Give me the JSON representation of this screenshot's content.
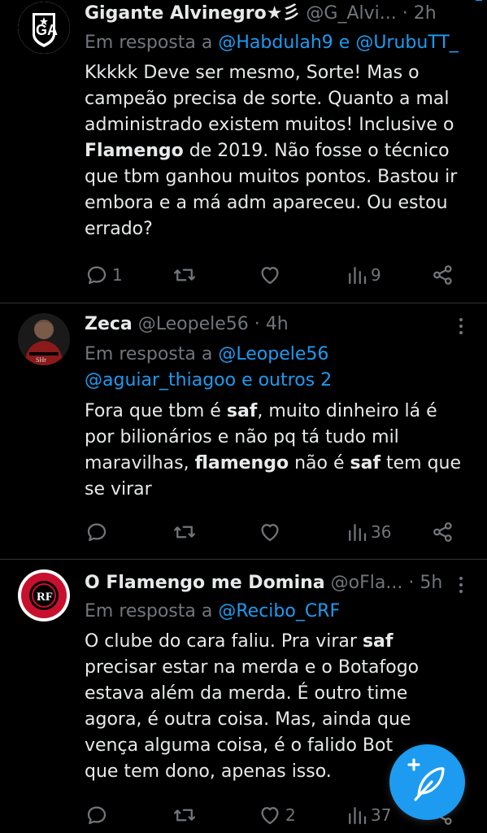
{
  "tweets": [
    {
      "name": "Gigante Alvinegro★彡",
      "handle": "@G_Alvi...",
      "dot": "·",
      "time": "2h",
      "reply_prefix": "Em resposta a ",
      "reply_link1": "@Habdulah9 e @UrubuTT_",
      "text_lines": [
        "Kkkkk Deve ser mesmo, Sorte! Mas o",
        "campeão precisa de sorte. Quanto a mal",
        "administrado existem muitos! Inclusive o"
      ],
      "bold_word": "Flamengo",
      "text_after_bold": " de 2019. Não fosse o técnico",
      "text_lines2": [
        "que tbm ganhou muitos pontos. Bastou ir",
        "embora e a má adm apareceu. Ou estou",
        "errado?"
      ],
      "replies": "1",
      "retweets": "",
      "likes": "",
      "views": "9"
    },
    {
      "name": "Zeca",
      "handle": "@Leopele56",
      "dot": "·",
      "time": "4h",
      "reply_prefix": "Em resposta a ",
      "reply_link1": "@Leopele56",
      "reply_link2": "@aguiar_thiagoo e outros 2",
      "t1a": "Fora que tbm é ",
      "t1b": "saf",
      "t1c": ", muito dinheiro lá é",
      "t2": "por bilionários e não pq tá tudo mil",
      "t3a": "maravilhas, ",
      "t3b": "flamengo",
      "t3c": " não é ",
      "t3d": "saf",
      "t3e": " tem que",
      "t4": "se virar",
      "replies": "",
      "retweets": "",
      "likes": "",
      "views": "36"
    },
    {
      "name": "O Flamengo me Domina",
      "handle": "@oFla...",
      "dot": "·",
      "time": "5h",
      "reply_prefix": "Em resposta a ",
      "reply_link1": "@Recibo_CRF",
      "t1a": "O clube do cara faliu. Pra virar ",
      "t1b": "saf",
      "t2": "precisar estar na merda e o Botafogo",
      "t3": "estava além da merda. É outro time",
      "t4": "agora, é outra coisa. Mas, ainda que",
      "t5": "vença alguma coisa, é o falido Bot",
      "t6": "que tem dono, apenas isso.",
      "replies": "",
      "retweets": "",
      "likes": "2",
      "views": "37"
    }
  ],
  "icons": {
    "reply": "reply-icon",
    "retweet": "retweet-icon",
    "like": "heart-icon",
    "views": "views-icon",
    "share": "share-icon",
    "more": "more-icon",
    "compose": "compose-icon"
  },
  "colors": {
    "background": "#000000",
    "text": "#e7e9ea",
    "muted": "#71767b",
    "link": "#1d9bf0",
    "divider": "#2f3336",
    "fab": "#1d9bf0"
  }
}
